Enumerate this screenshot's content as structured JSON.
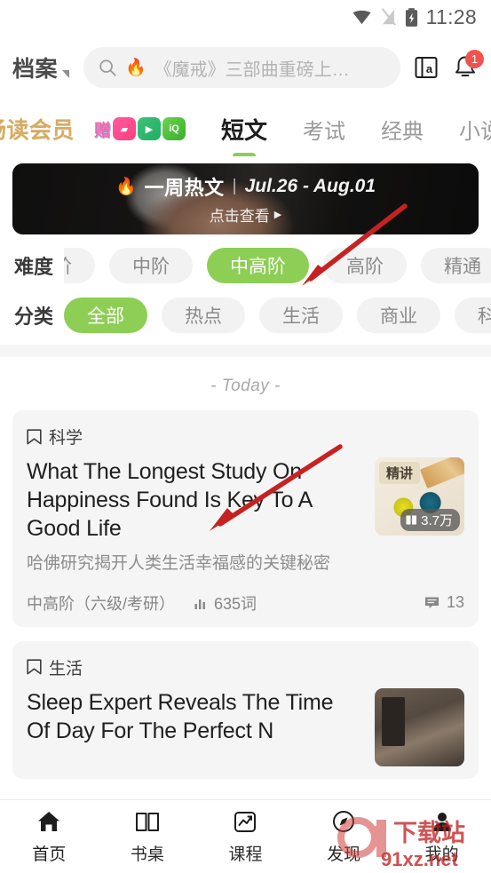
{
  "statusbar": {
    "time": "11:28",
    "icons": [
      "wifi-icon",
      "no-signal-icon",
      "battery-charging-icon"
    ]
  },
  "header": {
    "brand": "档案",
    "search": {
      "placeholder": "《魔戒》三部曲重磅上…",
      "hot_icon": "fire-icon",
      "search_icon": "search-icon"
    },
    "dictionary_icon": "dictionary-icon",
    "notification_icon": "bell-icon",
    "notification_badge": "1"
  },
  "tabstrip": {
    "vip_label": "畅读会员",
    "gift_label": "赠",
    "gift_apps": [
      "bilibili",
      "youku",
      "iqiyi"
    ],
    "tabs": [
      {
        "label": "短文",
        "active": true
      },
      {
        "label": "考试",
        "active": false
      },
      {
        "label": "经典",
        "active": false
      },
      {
        "label": "小说",
        "active": false
      }
    ]
  },
  "banner": {
    "flame_icon": "flame-icon",
    "title": "一周热文",
    "separator": "|",
    "date_range": "Jul.26 - Aug.01",
    "cta": "点击查看",
    "cta_icon": "play-triangle-icon"
  },
  "filters": [
    {
      "label": "难度",
      "chips": [
        {
          "label": "阶",
          "selected": false,
          "clipped": true
        },
        {
          "label": "中阶",
          "selected": false
        },
        {
          "label": "中高阶",
          "selected": true
        },
        {
          "label": "高阶",
          "selected": false
        },
        {
          "label": "精通",
          "selected": false
        }
      ]
    },
    {
      "label": "分类",
      "chips": [
        {
          "label": "全部",
          "selected": true
        },
        {
          "label": "热点",
          "selected": false
        },
        {
          "label": "生活",
          "selected": false
        },
        {
          "label": "商业",
          "selected": false
        },
        {
          "label": "科技",
          "selected": false
        }
      ]
    }
  ],
  "feed": {
    "day_label": "- Today -",
    "articles": [
      {
        "category": "科学",
        "title": "What The Longest Study On Happiness Found Is Key To A Good Life",
        "subtitle": "哈佛研究揭开人类生活幸福感的关键秘密",
        "level": "中高阶（六级/考研）",
        "words": "635词",
        "comments": "13",
        "thumb_badge": "精讲",
        "thumb_reads": "3.7万"
      },
      {
        "category": "生活",
        "title": "Sleep Expert Reveals The Time Of Day For The Perfect N",
        "subtitle": "",
        "level": "",
        "words": "",
        "comments": "",
        "thumb_badge": "",
        "thumb_reads": ""
      }
    ]
  },
  "bottomnav": [
    {
      "label": "首页",
      "icon": "home-icon",
      "active": true
    },
    {
      "label": "书桌",
      "icon": "book-open-icon",
      "active": false
    },
    {
      "label": "课程",
      "icon": "chart-square-icon",
      "active": false
    },
    {
      "label": "发现",
      "icon": "compass-icon",
      "active": false
    },
    {
      "label": "我的",
      "icon": "person-icon",
      "active": false
    }
  ],
  "watermark": {
    "brand": "下载站",
    "site": "91xz.net",
    "number": "91"
  },
  "colors": {
    "accent_green": "#8dce54",
    "badge_red": "#f2524e",
    "vip_gold": "#d8ab5e",
    "annotation_red": "#c62222"
  }
}
